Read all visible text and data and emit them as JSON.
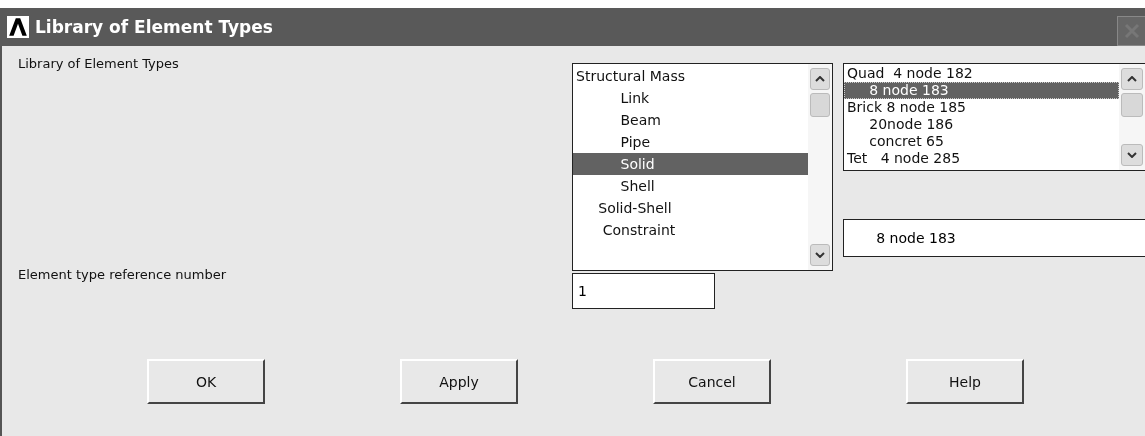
{
  "window": {
    "title": "Library of Element Types"
  },
  "library_label": "Library of Element Types",
  "category_list": {
    "items": [
      {
        "label": "Structural Mass",
        "selected": false
      },
      {
        "label": "          Link",
        "selected": false
      },
      {
        "label": "          Beam",
        "selected": false
      },
      {
        "label": "          Pipe",
        "selected": false
      },
      {
        "label": "          Solid",
        "selected": true
      },
      {
        "label": "          Shell",
        "selected": false
      },
      {
        "label": "     Solid-Shell",
        "selected": false
      },
      {
        "label": "      Constraint",
        "selected": false
      }
    ]
  },
  "element_list": {
    "items": [
      {
        "label": "Quad  4 node 182",
        "selected": false
      },
      {
        "label": "     8 node 183",
        "selected": true
      },
      {
        "label": "Brick 8 node 185",
        "selected": false
      },
      {
        "label": "     20node 186",
        "selected": false
      },
      {
        "label": "     concret 65",
        "selected": false
      },
      {
        "label": "Tet   4 node 285",
        "selected": false
      }
    ]
  },
  "selected_element": {
    "value": "     8 node 183"
  },
  "reference_number": {
    "label": "Element type reference number",
    "value": "1"
  },
  "buttons": [
    "OK",
    "Apply",
    "Cancel",
    "Help"
  ]
}
